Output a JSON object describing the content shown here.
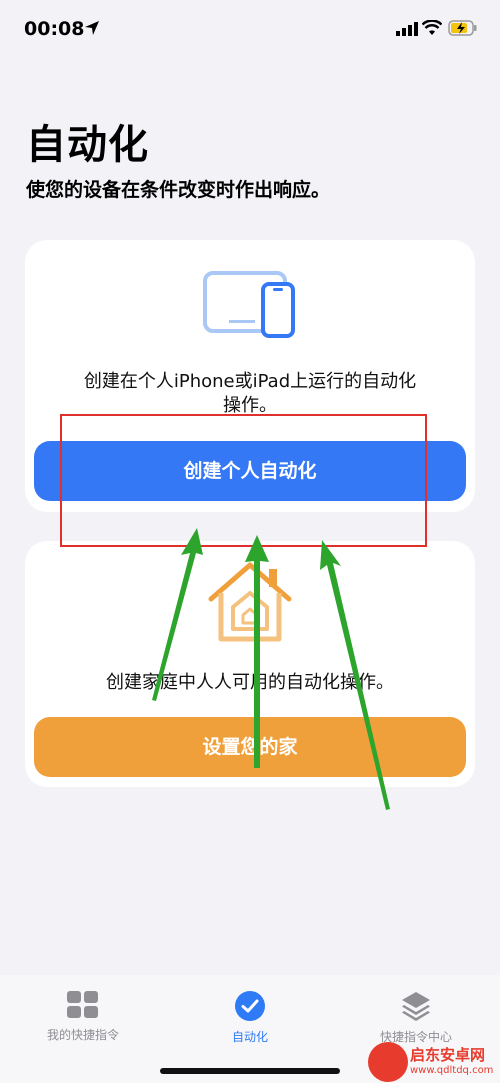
{
  "status_bar": {
    "time": "00:08"
  },
  "header": {
    "title": "自动化",
    "subtitle": "使您的设备在条件改变时作出响应。"
  },
  "personal_card": {
    "icon": "device-iphone-ipad-icon",
    "description_line1": "创建在个人iPhone或iPad上运行的自动化",
    "description_line2": "操作。",
    "button_label": "创建个人自动化"
  },
  "home_card": {
    "icon": "home-icon",
    "description": "创建家庭中人人可用的自动化操作。",
    "button_label": "设置您的家"
  },
  "tab_bar": {
    "tabs": [
      {
        "label": "我的快捷指令",
        "icon": "grid-icon",
        "active": false
      },
      {
        "label": "自动化",
        "icon": "automation-check-icon",
        "active": true
      },
      {
        "label": "快捷指令中心",
        "icon": "layers-icon",
        "active": false
      }
    ]
  },
  "watermark": {
    "name": "启东安卓网",
    "url": "www.qdltdq.com"
  },
  "colors": {
    "accent_blue": "#3478f6",
    "accent_orange": "#f0a03a",
    "annotation_red": "#e0302c",
    "annotation_arrow_green": "#2da52d",
    "background": "#f2f2f7"
  }
}
